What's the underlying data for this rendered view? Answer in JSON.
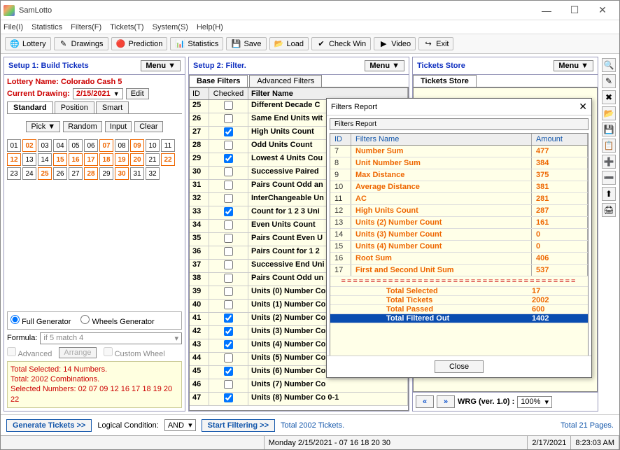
{
  "app": {
    "title": "SamLotto"
  },
  "menubar": [
    "File(I)",
    "Statistics",
    "Filters(F)",
    "Tickets(T)",
    "System(S)",
    "Help(H)"
  ],
  "toolbar": [
    {
      "icon": "🌐",
      "label": "Lottery"
    },
    {
      "icon": "✎",
      "label": "Drawings"
    },
    {
      "icon": "🔴",
      "label": "Prediction"
    },
    {
      "icon": "📊",
      "label": "Statistics"
    },
    {
      "icon": "💾",
      "label": "Save"
    },
    {
      "icon": "📂",
      "label": "Load"
    },
    {
      "icon": "✔",
      "label": "Check Win"
    },
    {
      "icon": "▶",
      "label": "Video"
    },
    {
      "icon": "↪",
      "label": "Exit"
    }
  ],
  "panel_menu": "Menu ▼",
  "setup1": {
    "title": "Setup 1: Build  Tickets",
    "lottery_label": "Lottery  Name: Colorado Cash 5",
    "drawing_label": "Current Drawing:",
    "drawing_date": "2/15/2021",
    "edit": "Edit",
    "tabs": [
      "Standard",
      "Position",
      "Smart"
    ],
    "buttons": {
      "pick": "Pick ▼",
      "random": "Random",
      "input": "Input",
      "clear": "Clear"
    },
    "picked": [
      2,
      7,
      9,
      12,
      16,
      17,
      18,
      19,
      20,
      22,
      30,
      15,
      25,
      28
    ],
    "max_num": 32,
    "gen_full": "Full Generator",
    "gen_wheel": "Wheels Generator",
    "formula_label": "Formula:",
    "formula_value": "if 5 match 4",
    "advanced": "Advanced",
    "arrange": "Arrange",
    "custom": "Custom Wheel",
    "summary1": "Total Selected: 14 Numbers.",
    "summary2": "Total: 2002 Combinations.",
    "summary3": "Selected Numbers: 02 07 09 12 16 17 18 19 20 22"
  },
  "setup2": {
    "title": "Setup 2: Filter.",
    "tabs": [
      "Base Filters",
      "Advanced Filters"
    ],
    "cols": {
      "id": "ID",
      "chk": "Checked",
      "name": "Filter Name"
    },
    "rows": [
      {
        "id": 25,
        "chk": false,
        "name": "Different Decade C"
      },
      {
        "id": 26,
        "chk": false,
        "name": "Same End Units wit"
      },
      {
        "id": 27,
        "chk": true,
        "name": "High Units Count"
      },
      {
        "id": 28,
        "chk": false,
        "name": "Odd Units Count"
      },
      {
        "id": 29,
        "chk": true,
        "name": "Lowest 4 Units Cou"
      },
      {
        "id": 30,
        "chk": false,
        "name": "Successive Paired"
      },
      {
        "id": 31,
        "chk": false,
        "name": "Pairs Count Odd an"
      },
      {
        "id": 32,
        "chk": false,
        "name": "InterChangeable Un"
      },
      {
        "id": 33,
        "chk": true,
        "name": "Count for 1 2 3 Uni"
      },
      {
        "id": 34,
        "chk": false,
        "name": "Even Units Count"
      },
      {
        "id": 35,
        "chk": false,
        "name": "Pairs Count Even U"
      },
      {
        "id": 36,
        "chk": false,
        "name": "Pairs Count for 1 2"
      },
      {
        "id": 37,
        "chk": false,
        "name": "Successive End Uni"
      },
      {
        "id": 38,
        "chk": false,
        "name": "Pairs Count Odd un"
      },
      {
        "id": 39,
        "chk": false,
        "name": "Units (0) Number Co"
      },
      {
        "id": 40,
        "chk": false,
        "name": "Units (1) Number Co"
      },
      {
        "id": 41,
        "chk": true,
        "name": "Units (2) Number Co"
      },
      {
        "id": 42,
        "chk": true,
        "name": "Units (3) Number Co"
      },
      {
        "id": 43,
        "chk": true,
        "name": "Units (4) Number Co"
      },
      {
        "id": 44,
        "chk": false,
        "name": "Units (5) Number Co"
      },
      {
        "id": 45,
        "chk": true,
        "name": "Units (6) Number Co"
      },
      {
        "id": 46,
        "chk": false,
        "name": "Units (7) Number Co"
      },
      {
        "id": 47,
        "chk": true,
        "name": "Units (8) Number Co 0-1"
      }
    ]
  },
  "store": {
    "title": "Tickets Store",
    "tab": "Tickets Store",
    "nav_prev": "«",
    "nav_next": "»",
    "wrg": "WRG (ver. 1.0) :",
    "zoom": "100%"
  },
  "bottom": {
    "generate": "Generate Tickets >>",
    "logical": "Logical Condition:",
    "and": "AND",
    "start": "Start Filtering >>",
    "total": "Total 2002 Tickets.",
    "pages": "Total 21 Pages."
  },
  "status": {
    "mid": "Monday 2/15/2021 - 07 16 18 20 30",
    "date": "2/17/2021",
    "time": "8:23:03 AM"
  },
  "popup": {
    "title": "Filters Report",
    "sub": "Filters Report",
    "cols": {
      "id": "ID",
      "name": "Filters Name",
      "amt": "Amount"
    },
    "rows": [
      {
        "id": 7,
        "name": "Number Sum",
        "amt": 477
      },
      {
        "id": 8,
        "name": "Unit Number Sum",
        "amt": 384
      },
      {
        "id": 9,
        "name": "Max Distance",
        "amt": 375
      },
      {
        "id": 10,
        "name": "Average Distance",
        "amt": 381
      },
      {
        "id": 11,
        "name": "AC",
        "amt": 281
      },
      {
        "id": 12,
        "name": "High Units Count",
        "amt": 287
      },
      {
        "id": 13,
        "name": "Units (2) Number Count",
        "amt": 161
      },
      {
        "id": 14,
        "name": "Units (3) Number Count",
        "amt": 0
      },
      {
        "id": 15,
        "name": "Units (4) Number Count",
        "amt": 0
      },
      {
        "id": 16,
        "name": "Root Sum",
        "amt": 406
      },
      {
        "id": 17,
        "name": "First and Second Unit Sum",
        "amt": 537
      }
    ],
    "totals": [
      {
        "name": "Total Selected",
        "amt": 17
      },
      {
        "name": "Total Tickets",
        "amt": 2002
      },
      {
        "name": "Total Passed",
        "amt": 600
      },
      {
        "name": "Total Filtered Out",
        "amt": 1402,
        "sel": true
      }
    ],
    "close": "Close"
  },
  "side_icons": [
    "🔍",
    "✎",
    "✖",
    "📂",
    "💾",
    "📋",
    "➕",
    "➖",
    "⬆",
    "🖨"
  ]
}
